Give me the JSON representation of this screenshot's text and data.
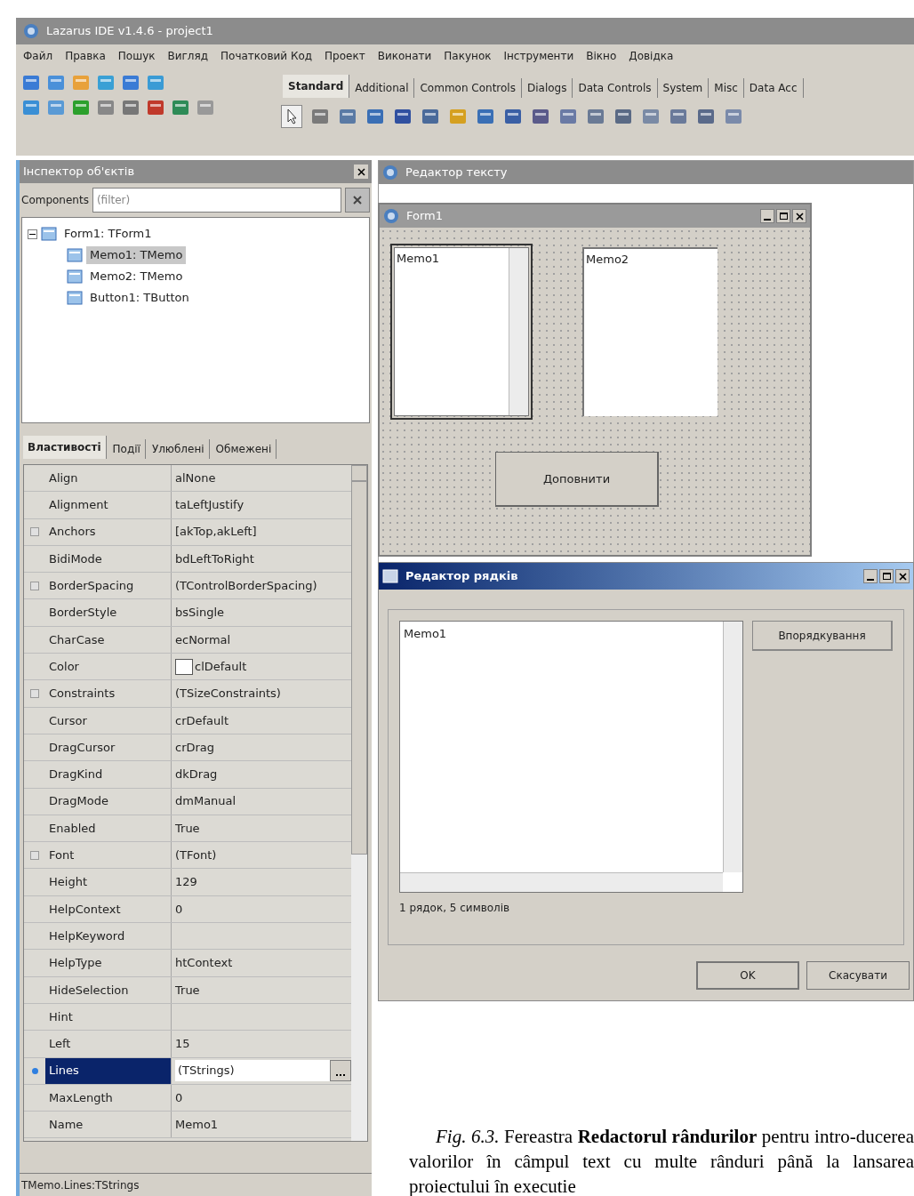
{
  "ide": {
    "title": "Lazarus IDE v1.4.6 - project1",
    "menu": [
      "Файл",
      "Правка",
      "Пошук",
      "Вигляд",
      "Початковий Код",
      "Проект",
      "Виконати",
      "Пакунок",
      "Інструменти",
      "Вікно",
      "Довідка"
    ],
    "palette_tabs": [
      {
        "label": "Standard",
        "selected": true
      },
      {
        "label": "Additional",
        "selected": false
      },
      {
        "label": "Common Controls",
        "selected": false
      },
      {
        "label": "Dialogs",
        "selected": false
      },
      {
        "label": "Data Controls",
        "selected": false
      },
      {
        "label": "System",
        "selected": false
      },
      {
        "label": "Misc",
        "selected": false
      },
      {
        "label": "Data Acc",
        "selected": false
      }
    ]
  },
  "object_inspector": {
    "title": "Інспектор об'єктів",
    "components_label": "Components",
    "filter_placeholder": "(filter)",
    "tree": [
      {
        "label": "Form1: TForm1",
        "expanded": true,
        "selected": false,
        "children": [
          {
            "label": "Memo1: TMemo",
            "selected": true
          },
          {
            "label": "Memo2: TMemo",
            "selected": false
          },
          {
            "label": "Button1: TButton",
            "selected": false
          }
        ]
      }
    ],
    "tabs": [
      {
        "label": "Властивості",
        "selected": true
      },
      {
        "label": "Події",
        "selected": false
      },
      {
        "label": "Улюблені",
        "selected": false
      },
      {
        "label": "Обмежені",
        "selected": false
      }
    ],
    "properties": [
      {
        "name": "Align",
        "value": "alNone",
        "kind": "plain",
        "selected": false
      },
      {
        "name": "Alignment",
        "value": "taLeftJustify",
        "kind": "plain",
        "selected": false
      },
      {
        "name": "Anchors",
        "value": "[akTop,akLeft]",
        "kind": "group",
        "selected": false
      },
      {
        "name": "BidiMode",
        "value": "bdLeftToRight",
        "kind": "plain",
        "selected": false
      },
      {
        "name": "BorderSpacing",
        "value": "(TControlBorderSpacing)",
        "kind": "group",
        "selected": false
      },
      {
        "name": "BorderStyle",
        "value": "bsSingle",
        "kind": "plain",
        "selected": false
      },
      {
        "name": "CharCase",
        "value": "ecNormal",
        "kind": "plain",
        "selected": false
      },
      {
        "name": "Color",
        "value": "clDefault",
        "kind": "color",
        "selected": false
      },
      {
        "name": "Constraints",
        "value": "(TSizeConstraints)",
        "kind": "group",
        "selected": false
      },
      {
        "name": "Cursor",
        "value": "crDefault",
        "kind": "plain",
        "selected": false
      },
      {
        "name": "DragCursor",
        "value": "crDrag",
        "kind": "plain",
        "selected": false
      },
      {
        "name": "DragKind",
        "value": "dkDrag",
        "kind": "plain",
        "selected": false
      },
      {
        "name": "DragMode",
        "value": "dmManual",
        "kind": "plain",
        "selected": false
      },
      {
        "name": "Enabled",
        "value": "True",
        "kind": "plain",
        "selected": false
      },
      {
        "name": "Font",
        "value": "(TFont)",
        "kind": "group",
        "selected": false
      },
      {
        "name": "Height",
        "value": "129",
        "kind": "plain",
        "selected": false
      },
      {
        "name": "HelpContext",
        "value": "0",
        "kind": "plain",
        "selected": false
      },
      {
        "name": "HelpKeyword",
        "kind": "plain",
        "selected": false
      },
      {
        "name": "HelpType",
        "value": "htContext",
        "kind": "plain",
        "selected": false
      },
      {
        "name": "HideSelection",
        "value": "True",
        "kind": "plain",
        "selected": false
      },
      {
        "name": "Hint",
        "kind": "plain",
        "selected": false
      },
      {
        "name": "Left",
        "value": "15",
        "kind": "plain",
        "selected": false
      },
      {
        "name": "Lines",
        "value": "(TStrings)",
        "kind": "editor",
        "selected": true
      },
      {
        "name": "MaxLength",
        "value": "0",
        "kind": "plain",
        "selected": false
      },
      {
        "name": "Name",
        "value": "Memo1",
        "kind": "plain",
        "selected": false
      }
    ],
    "status": "TMemo.Lines:TStrings"
  },
  "source_editor": {
    "title": "Редактор тексту"
  },
  "form_designer": {
    "title": "Form1",
    "memos": [
      {
        "text": "Memo1",
        "selected": true
      },
      {
        "text": "Memo2",
        "selected": false
      }
    ],
    "button": "Доповнити"
  },
  "strings_editor": {
    "title": "Редактор рядків",
    "memo_text": "Memo1",
    "sort_button": "Впорядкування",
    "status": "1 рядок, 5 символів",
    "buttons": [
      "OK",
      "Скасувати"
    ]
  },
  "caption": "*Fig. 6.3.* Fereastra **Redactorul rândurilor** pentru intro-ducerea valorilor în câmpul text cu multe rânduri până la lansarea proiectului în executie"
}
